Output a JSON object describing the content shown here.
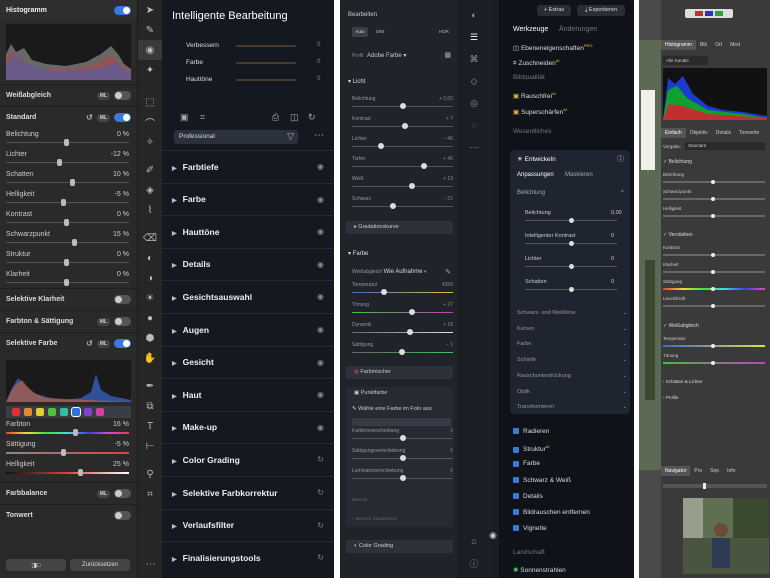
{
  "p1": {
    "histogram": "Histogramm",
    "wb": "Weißabgleich",
    "ml": "ML",
    "standard": "Standard",
    "sliders": [
      {
        "label": "Belichtung",
        "value": "0 %",
        "pos": 0.5
      },
      {
        "label": "Lichter",
        "value": "-12 %",
        "pos": 0.44
      },
      {
        "label": "Schatten",
        "value": "10 %",
        "pos": 0.55
      },
      {
        "label": "Helligkeit",
        "value": "-5 %",
        "pos": 0.47
      },
      {
        "label": "Kontrast",
        "value": "0 %",
        "pos": 0.5
      },
      {
        "label": "Schwarzpunkt",
        "value": "15 %",
        "pos": 0.57
      },
      {
        "label": "Struktur",
        "value": "0 %",
        "pos": 0.5
      },
      {
        "label": "Klarheit",
        "value": "0 %",
        "pos": 0.5
      }
    ],
    "sel_clarity": "Selektive Klarheit",
    "tone_sat": "Farbton & Sättigung",
    "sel_color": "Selektive Farbe",
    "swatches": [
      "#e03030",
      "#e08a30",
      "#e0d030",
      "#50c040",
      "#30c0a0",
      "#3070e0",
      "#8040d0",
      "#d040a0"
    ],
    "color_sliders": [
      {
        "label": "Farbton",
        "value": "16 %",
        "pos": 0.58
      },
      {
        "label": "Sättigung",
        "value": "-5 %",
        "pos": 0.47
      },
      {
        "label": "Helligkeit",
        "value": "25 %",
        "pos": 0.62
      }
    ],
    "color_balance": "Farbbalance",
    "toning": "Tonwert",
    "reset": "Zurücksetzen"
  },
  "p2": {
    "title": "Intelligente Bearbeitung",
    "mini": [
      {
        "label": "Verbessern",
        "value": "0"
      },
      {
        "label": "Farbe",
        "value": "0"
      },
      {
        "label": "Hauttöne",
        "value": "0"
      }
    ],
    "profile": "Professional",
    "categories": [
      "Farbtiefe",
      "Farbe",
      "Hauttöne",
      "Details",
      "Gesichtsauswahl",
      "Augen",
      "Gesicht",
      "Haut",
      "Make-up",
      "Color Grading",
      "Selektive Farbkorrektur",
      "Verlaufsfilter",
      "Finalisierungstools"
    ]
  },
  "p3": {
    "edit": "Bearbeiten",
    "auto": "Auto",
    "bw": "S/W",
    "hdr": "HDR",
    "profile_label": "Profil",
    "profile": "Adobe Farbe",
    "light": "Licht",
    "light_sliders": [
      {
        "label": "Belichtung",
        "value": "+ 0,00",
        "pos": 0.5
      },
      {
        "label": "Kontrast",
        "value": "+ 7",
        "pos": 0.53
      },
      {
        "label": "Lichter",
        "value": "− 46",
        "pos": 0.27
      },
      {
        "label": "Tiefen",
        "value": "+ 46",
        "pos": 0.73
      },
      {
        "label": "Weiß",
        "value": "+ 19",
        "pos": 0.6
      },
      {
        "label": "Schwarz",
        "value": "− 21",
        "pos": 0.4
      }
    ],
    "curve": "Gradationskurve",
    "color": "Farbe",
    "wb_label": "Weißabgleich",
    "wb_value": "Wie Aufnahme",
    "color_sliders": [
      {
        "label": "Temperatur",
        "value": "4350",
        "pos": 0.3
      },
      {
        "label": "Tönung",
        "value": "+ 27",
        "pos": 0.6
      },
      {
        "label": "Dynamik",
        "value": "+ 18",
        "pos": 0.58
      },
      {
        "label": "Sättigung",
        "value": "− 1",
        "pos": 0.49
      }
    ],
    "mixer": "Farbmischer",
    "point": "Punktfarbe",
    "pick": "Wähle eine Farbe im Foto aus",
    "point_sliders": [
      {
        "label": "Farbtonverschiebung",
        "value": "0"
      },
      {
        "label": "Sättigungsverschiebung",
        "value": "0"
      },
      {
        "label": "Luminanzverschiebung",
        "value": "0"
      }
    ],
    "range": "Bereich",
    "show_mask": "Bereich visualisieren",
    "grading": "Color Grading"
  },
  "p4": {
    "extras": "Extras",
    "export": "Exportieren",
    "tools": "Werkzeuge",
    "changes": "Änderungen",
    "tools_list": [
      "Ebeneneigenschaften",
      "Zuschneiden"
    ],
    "pro": "PRO",
    "ai": "AI",
    "quality": "Bildqualität",
    "quality_list": [
      "Rauschfrei",
      "Superschärfen"
    ],
    "essentials": "Wesentliches",
    "develop": "Entwickeln",
    "adjust": "Anpassungen",
    "mask": "Maskieren",
    "exposure": "Belichtung",
    "sliders": [
      {
        "label": "Belichtung",
        "value": "0,00",
        "pos": 0.5
      },
      {
        "label": "Intelligenter Kontrast",
        "value": "0",
        "pos": 0.5
      },
      {
        "label": "Lichter",
        "value": "0",
        "pos": 0.5
      },
      {
        "label": "Schatten",
        "value": "0",
        "pos": 0.5
      }
    ],
    "groups": [
      "Schwarz- und Weißtöne",
      "Kurven",
      "Farbe",
      "Schärfe",
      "Rauschunterdrückung",
      "Optik",
      "Transformieren"
    ],
    "list": [
      "Radieren",
      "Struktur",
      "Farbe",
      "Schwarz & Weiß",
      "Details",
      "Bildrauschen entfernen",
      "Vignette"
    ],
    "landscape": "Landschaft",
    "sunrays": "Sonnenstrahlen"
  },
  "p5": {
    "tabs": [
      "Histogramm",
      "Bib",
      "Ort",
      "Med"
    ],
    "channels": "Alle Kanäle",
    "tabs2": [
      "Einfach",
      "Objektiv",
      "Details",
      "Tonwerte"
    ],
    "preset_label": "Vorgabe:",
    "preset": "Standard",
    "exposure": "Belichtung",
    "exp_sliders": [
      "Belichtung",
      "Schwarzpunkt",
      "Helligkeit"
    ],
    "enhance": "Verstärken",
    "enh_sliders": [
      "Kontrast",
      "Klarheit",
      "Sättigung",
      "Leuchtkraft"
    ],
    "wb": "Weißabgleich",
    "wb_sliders": [
      "Temperatur",
      "Tönung"
    ],
    "shadows": "Schatten & Lichter",
    "profile": "Profile",
    "nav_tabs": [
      "Navigator",
      "Pro",
      "Snp",
      "Info"
    ]
  }
}
